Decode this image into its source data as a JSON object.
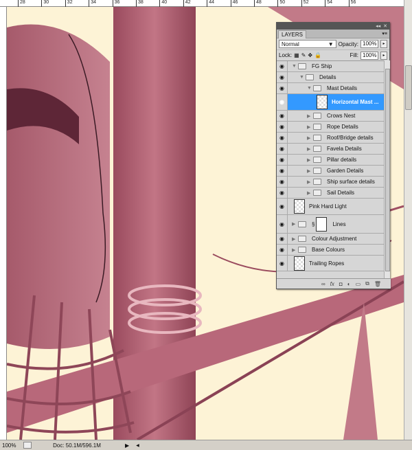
{
  "ruler": {
    "top_labels": [
      "28",
      "30",
      "32",
      "34",
      "36",
      "38",
      "40",
      "42",
      "44",
      "46",
      "48",
      "50",
      "52",
      "54",
      "56"
    ]
  },
  "status": {
    "zoom": "100%",
    "doc": "Doc: 50.1M/596.1M"
  },
  "layers_panel": {
    "tab": "LAYERS",
    "blend_mode": "Normal",
    "opacity_label": "Opacity:",
    "opacity": "100%",
    "lock_label": "Lock:",
    "fill_label": "Fill:",
    "fill": "100%",
    "layers": [
      {
        "name": "FG Ship",
        "type": "group",
        "indent": 0,
        "expanded": true
      },
      {
        "name": "Details",
        "type": "group",
        "indent": 1,
        "expanded": true
      },
      {
        "name": "Mast Details",
        "type": "group",
        "indent": 2,
        "expanded": true
      },
      {
        "name": "Horizontal Mast ...",
        "type": "layer",
        "indent": 3,
        "selected": true
      },
      {
        "name": "Crows Nest",
        "type": "group",
        "indent": 2
      },
      {
        "name": "Rope Details",
        "type": "group",
        "indent": 2
      },
      {
        "name": "Roof/Bridge details",
        "type": "group",
        "indent": 2
      },
      {
        "name": "Favela Details",
        "type": "group",
        "indent": 2
      },
      {
        "name": "Pillar details",
        "type": "group",
        "indent": 2
      },
      {
        "name": "Garden Details",
        "type": "group",
        "indent": 2
      },
      {
        "name": "Ship surface details",
        "type": "group",
        "indent": 2
      },
      {
        "name": "Sail Details",
        "type": "group",
        "indent": 2
      },
      {
        "name": "Pink Hard Light",
        "type": "layer",
        "indent": 0
      },
      {
        "name": "Lines",
        "type": "masked-group",
        "indent": 0
      },
      {
        "name": "Colour Adjustment",
        "type": "group",
        "indent": 0
      },
      {
        "name": "Base Colours",
        "type": "group",
        "indent": 0
      },
      {
        "name": "Trailing Ropes",
        "type": "layer",
        "indent": 0
      }
    ]
  },
  "colors": {
    "selection": "#3399ff",
    "artwork_pink": "#b0606f",
    "background_cream": "#fdf3d6"
  }
}
